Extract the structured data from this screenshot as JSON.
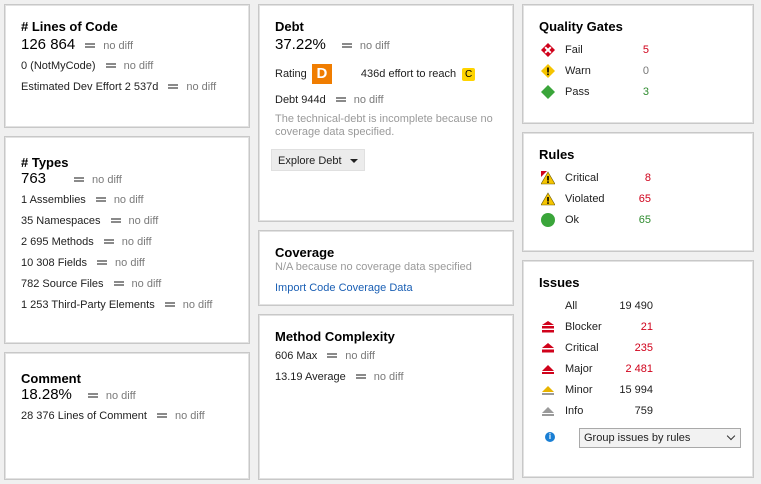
{
  "loc": {
    "title": "# Lines of Code",
    "value": "126 864",
    "value_diff": "no diff",
    "rows": [
      {
        "label": "0  (NotMyCode)",
        "diff": "no diff"
      },
      {
        "label": "Estimated Dev Effort   2 537d",
        "diff": "no diff"
      }
    ]
  },
  "types": {
    "title": "# Types",
    "value": "763",
    "value_diff": "no diff",
    "rows": [
      {
        "label": "1   Assemblies",
        "diff": "no diff"
      },
      {
        "label": "35   Namespaces",
        "diff": "no diff"
      },
      {
        "label": "2 695   Methods",
        "diff": "no diff"
      },
      {
        "label": "10 308   Fields",
        "diff": "no diff"
      },
      {
        "label": "782   Source Files",
        "diff": "no diff"
      },
      {
        "label": "1 253   Third-Party Elements",
        "diff": "no diff"
      }
    ]
  },
  "comment": {
    "title": "Comment",
    "value": "18.28%",
    "value_diff": "no diff",
    "rows": [
      {
        "label": "28 376   Lines of Comment",
        "diff": "no diff"
      }
    ]
  },
  "debt": {
    "title": "Debt",
    "value": "37.22%",
    "value_diff": "no diff",
    "rating_label": "Rating",
    "rating_grade": "D",
    "effort_text": "436d effort to reach",
    "effort_grade": "C",
    "debt_row": {
      "label": "Debt   944d",
      "diff": "no diff"
    },
    "note": "The technical-debt is incomplete because no coverage data specified.",
    "explore_button": "Explore Debt"
  },
  "coverage": {
    "title": "Coverage",
    "note": "N/A because no coverage data specified",
    "import_link": "Import Code Coverage Data"
  },
  "complexity": {
    "title": "Method Complexity",
    "rows": [
      {
        "label": "606   Max",
        "diff": "no diff"
      },
      {
        "label": "13.19   Average",
        "diff": "no diff"
      }
    ]
  },
  "quality_gates": {
    "title": "Quality Gates",
    "items": [
      {
        "label": "Fail",
        "value": "5",
        "icon": "fail-icon",
        "color": "#d0021b"
      },
      {
        "label": "Warn",
        "value": "0",
        "icon": "warn-icon",
        "color": "#777777"
      },
      {
        "label": "Pass",
        "value": "3",
        "icon": "pass-icon",
        "color": "#2e8b2e"
      }
    ]
  },
  "rules": {
    "title": "Rules",
    "items": [
      {
        "label": "Critical",
        "value": "8",
        "icon": "critical-rule-icon",
        "color": "#d0021b"
      },
      {
        "label": "Violated",
        "value": "65",
        "icon": "warning-icon",
        "color": "#d0021b"
      },
      {
        "label": "Ok",
        "value": "65",
        "icon": "ok-icon",
        "color": "#2e8b2e"
      }
    ]
  },
  "issues": {
    "title": "Issues",
    "all_label": "All",
    "all_value": "19 490",
    "items": [
      {
        "label": "Blocker",
        "value": "21",
        "icon": "blocker-icon",
        "color": "#d0021b"
      },
      {
        "label": "Critical",
        "value": "235",
        "icon": "critical-icon",
        "color": "#d0021b"
      },
      {
        "label": "Major",
        "value": "2 481",
        "icon": "major-icon",
        "color": "#d0021b"
      },
      {
        "label": "Minor",
        "value": "15 994",
        "icon": "minor-icon",
        "color": "#1e1e1e"
      },
      {
        "label": "Info",
        "value": "759",
        "icon": "info-icon",
        "color": "#1e1e1e"
      }
    ],
    "group_select": "Group issues by rules"
  }
}
